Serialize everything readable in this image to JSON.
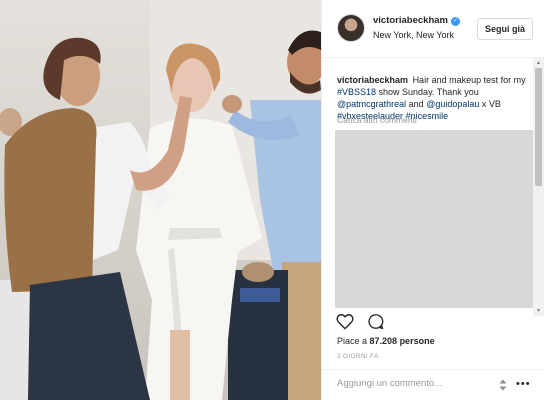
{
  "post": {
    "username": "victoriabeckham",
    "location": "New York, New York",
    "follow_label": "Segui già"
  },
  "caption": {
    "author": "victoriabeckham",
    "parts": [
      {
        "text": "Hair and makeup test for my ",
        "link": false
      },
      {
        "text": "#VBSS18",
        "link": true
      },
      {
        "text": " show Sunday. Thank you ",
        "link": false
      },
      {
        "text": "@patmcgrathreal",
        "link": true
      },
      {
        "text": " and ",
        "link": false
      },
      {
        "text": "@guidopalau",
        "link": true
      },
      {
        "text": " x VB ",
        "link": false
      },
      {
        "text": "#vbxesteelauder",
        "link": true
      },
      {
        "text": " ",
        "link": false
      },
      {
        "text": "#nicesmile",
        "link": true
      }
    ]
  },
  "comments": {
    "load_more_label": "Carica altri commenti"
  },
  "engagement": {
    "likes_prefix": "Piace a ",
    "likes_count": "87.208",
    "likes_suffix": " persone",
    "timestamp": "2 GIORNI FA"
  },
  "comment_box": {
    "placeholder": "Aggiungi un commento...",
    "more_glyph": "•••"
  },
  "colors": {
    "link": "#003569",
    "verified": "#3897f0",
    "muted": "#999999"
  }
}
